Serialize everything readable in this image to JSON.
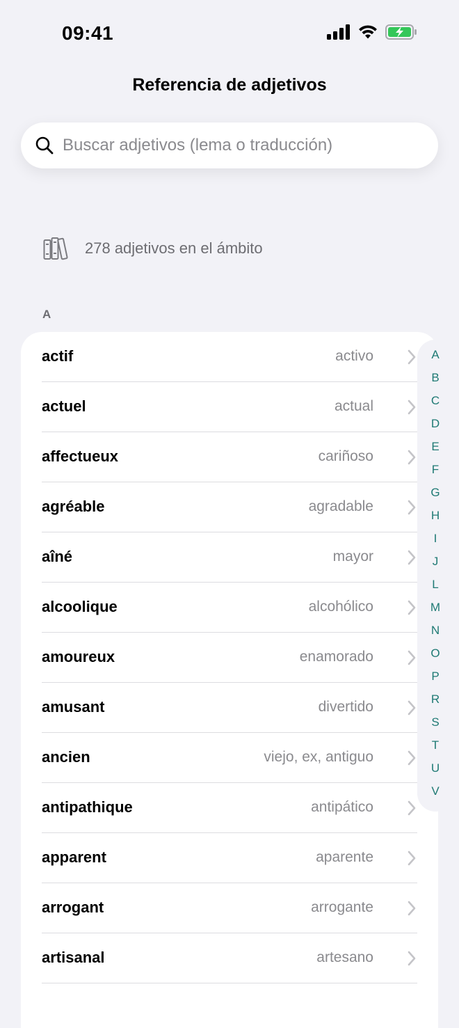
{
  "status_bar": {
    "time": "09:41"
  },
  "nav": {
    "title": "Referencia de adjetivos"
  },
  "search": {
    "placeholder": "Buscar adjetivos (lema o traducción)",
    "value": ""
  },
  "summary": {
    "count_text": "278 adjetivos en el ámbito"
  },
  "section": {
    "header": "A"
  },
  "colors": {
    "background": "#f2f2f7",
    "accent": "#1f7a74",
    "battery": "#34c759",
    "secondary_text": "#8a8a8e"
  },
  "adjectives": [
    {
      "lemma": "actif",
      "translation": "activo"
    },
    {
      "lemma": "actuel",
      "translation": "actual"
    },
    {
      "lemma": "affectueux",
      "translation": "cariñoso"
    },
    {
      "lemma": "agréable",
      "translation": "agradable"
    },
    {
      "lemma": "aîné",
      "translation": "mayor"
    },
    {
      "lemma": "alcoolique",
      "translation": "alcohólico"
    },
    {
      "lemma": "amoureux",
      "translation": "enamorado"
    },
    {
      "lemma": "amusant",
      "translation": "divertido"
    },
    {
      "lemma": "ancien",
      "translation": "viejo, ex, antiguo"
    },
    {
      "lemma": "antipathique",
      "translation": "antipático"
    },
    {
      "lemma": "apparent",
      "translation": "aparente"
    },
    {
      "lemma": "arrogant",
      "translation": "arrogante"
    },
    {
      "lemma": "artisanal",
      "translation": "artesano"
    }
  ],
  "index_letters": [
    "A",
    "B",
    "C",
    "D",
    "E",
    "F",
    "G",
    "H",
    "I",
    "J",
    "L",
    "M",
    "N",
    "O",
    "P",
    "R",
    "S",
    "T",
    "U",
    "V"
  ]
}
